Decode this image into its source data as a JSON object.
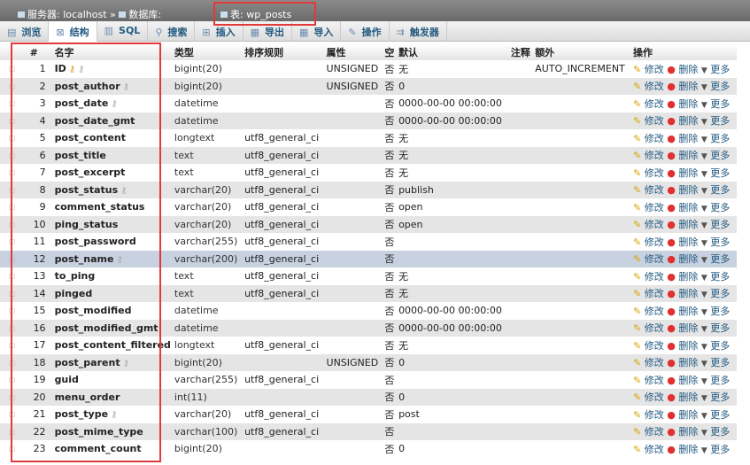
{
  "breadcrumb": {
    "server": "服务器: localhost",
    "sep": "»",
    "database": "数据库:",
    "table": "表: wp_posts"
  },
  "tabs": [
    {
      "label": "浏览",
      "icon": "browse-icon"
    },
    {
      "label": "结构",
      "icon": "structure-icon",
      "active": true
    },
    {
      "label": "SQL",
      "icon": "sql-icon"
    },
    {
      "label": "搜索",
      "icon": "search-icon"
    },
    {
      "label": "插入",
      "icon": "insert-icon"
    },
    {
      "label": "导出",
      "icon": "export-icon"
    },
    {
      "label": "导入",
      "icon": "import-icon"
    },
    {
      "label": "操作",
      "icon": "wrench-icon"
    },
    {
      "label": "触发器",
      "icon": "trigger-icon"
    }
  ],
  "headers": {
    "num": "#",
    "name": "名字",
    "type": "类型",
    "collation": "排序规则",
    "attributes": "属性",
    "null": "空",
    "default": "默认",
    "comment": "注释",
    "extra": "额外",
    "action": "操作"
  },
  "actions": {
    "edit": "修改",
    "drop": "删除",
    "more": "更多"
  },
  "rows": [
    {
      "n": "1",
      "name": "ID",
      "keys": [
        "primary",
        "index"
      ],
      "type": "bigint(20)",
      "coll": "",
      "attr": "UNSIGNED",
      "null": "否",
      "def": "无",
      "extra": "AUTO_INCREMENT"
    },
    {
      "n": "2",
      "name": "post_author",
      "keys": [
        "index"
      ],
      "type": "bigint(20)",
      "coll": "",
      "attr": "UNSIGNED",
      "null": "否",
      "def": "0",
      "extra": ""
    },
    {
      "n": "3",
      "name": "post_date",
      "keys": [
        "index"
      ],
      "type": "datetime",
      "coll": "",
      "attr": "",
      "null": "否",
      "def": "0000-00-00 00:00:00",
      "extra": ""
    },
    {
      "n": "4",
      "name": "post_date_gmt",
      "keys": [],
      "type": "datetime",
      "coll": "",
      "attr": "",
      "null": "否",
      "def": "0000-00-00 00:00:00",
      "extra": ""
    },
    {
      "n": "5",
      "name": "post_content",
      "keys": [],
      "type": "longtext",
      "coll": "utf8_general_ci",
      "attr": "",
      "null": "否",
      "def": "无",
      "extra": ""
    },
    {
      "n": "6",
      "name": "post_title",
      "keys": [],
      "type": "text",
      "coll": "utf8_general_ci",
      "attr": "",
      "null": "否",
      "def": "无",
      "extra": ""
    },
    {
      "n": "7",
      "name": "post_excerpt",
      "keys": [],
      "type": "text",
      "coll": "utf8_general_ci",
      "attr": "",
      "null": "否",
      "def": "无",
      "extra": ""
    },
    {
      "n": "8",
      "name": "post_status",
      "keys": [
        "index"
      ],
      "type": "varchar(20)",
      "coll": "utf8_general_ci",
      "attr": "",
      "null": "否",
      "def": "publish",
      "extra": ""
    },
    {
      "n": "9",
      "name": "comment_status",
      "keys": [],
      "type": "varchar(20)",
      "coll": "utf8_general_ci",
      "attr": "",
      "null": "否",
      "def": "open",
      "extra": ""
    },
    {
      "n": "10",
      "name": "ping_status",
      "keys": [],
      "type": "varchar(20)",
      "coll": "utf8_general_ci",
      "attr": "",
      "null": "否",
      "def": "open",
      "extra": ""
    },
    {
      "n": "11",
      "name": "post_password",
      "keys": [],
      "type": "varchar(255)",
      "coll": "utf8_general_ci",
      "attr": "",
      "null": "否",
      "def": "",
      "extra": ""
    },
    {
      "n": "12",
      "name": "post_name",
      "keys": [
        "index"
      ],
      "type": "varchar(200)",
      "coll": "utf8_general_ci",
      "attr": "",
      "null": "否",
      "def": "",
      "extra": "",
      "highlight": true
    },
    {
      "n": "13",
      "name": "to_ping",
      "keys": [],
      "type": "text",
      "coll": "utf8_general_ci",
      "attr": "",
      "null": "否",
      "def": "无",
      "extra": ""
    },
    {
      "n": "14",
      "name": "pinged",
      "keys": [],
      "type": "text",
      "coll": "utf8_general_ci",
      "attr": "",
      "null": "否",
      "def": "无",
      "extra": ""
    },
    {
      "n": "15",
      "name": "post_modified",
      "keys": [],
      "type": "datetime",
      "coll": "",
      "attr": "",
      "null": "否",
      "def": "0000-00-00 00:00:00",
      "extra": ""
    },
    {
      "n": "16",
      "name": "post_modified_gmt",
      "keys": [],
      "type": "datetime",
      "coll": "",
      "attr": "",
      "null": "否",
      "def": "0000-00-00 00:00:00",
      "extra": ""
    },
    {
      "n": "17",
      "name": "post_content_filtered",
      "keys": [],
      "type": "longtext",
      "coll": "utf8_general_ci",
      "attr": "",
      "null": "否",
      "def": "无",
      "extra": ""
    },
    {
      "n": "18",
      "name": "post_parent",
      "keys": [
        "index"
      ],
      "type": "bigint(20)",
      "coll": "",
      "attr": "UNSIGNED",
      "null": "否",
      "def": "0",
      "extra": ""
    },
    {
      "n": "19",
      "name": "guid",
      "keys": [],
      "type": "varchar(255)",
      "coll": "utf8_general_ci",
      "attr": "",
      "null": "否",
      "def": "",
      "extra": ""
    },
    {
      "n": "20",
      "name": "menu_order",
      "keys": [],
      "type": "int(11)",
      "coll": "",
      "attr": "",
      "null": "否",
      "def": "0",
      "extra": ""
    },
    {
      "n": "21",
      "name": "post_type",
      "keys": [
        "index"
      ],
      "type": "varchar(20)",
      "coll": "utf8_general_ci",
      "attr": "",
      "null": "否",
      "def": "post",
      "extra": ""
    },
    {
      "n": "22",
      "name": "post_mime_type",
      "keys": [],
      "type": "varchar(100)",
      "coll": "utf8_general_ci",
      "attr": "",
      "null": "否",
      "def": "",
      "extra": ""
    },
    {
      "n": "23",
      "name": "comment_count",
      "keys": [],
      "type": "bigint(20)",
      "coll": "",
      "attr": "",
      "null": "否",
      "def": "0",
      "extra": ""
    }
  ]
}
